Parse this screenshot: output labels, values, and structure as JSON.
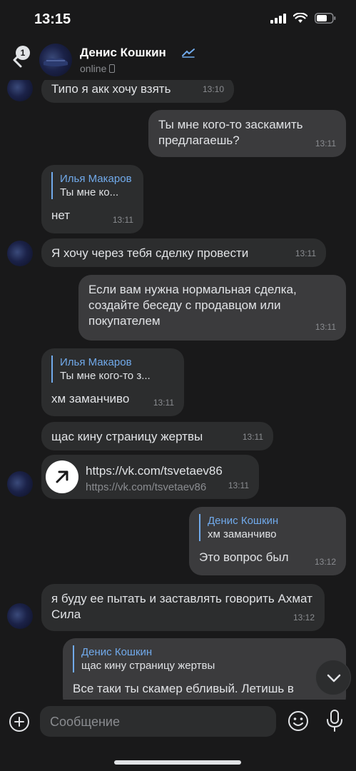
{
  "status": {
    "time": "13:15"
  },
  "header": {
    "back_badge": "1",
    "name": "Денис Кошкин",
    "status": "online"
  },
  "messages": [
    {
      "text": "Типо я акк хочу взять",
      "time": "13:10"
    },
    {
      "text": "Ты мне кого-то заскамить предлагаешь?",
      "time": "13:11"
    },
    {
      "reply_name": "Илья Макаров",
      "reply_text": "Ты мне ко...",
      "text": "нет",
      "time": "13:11"
    },
    {
      "text": "Я хочу через тебя сделку провести",
      "time": "13:11"
    },
    {
      "text": "Если вам нужна нормальная сделка, создайте беседу с продавцом или покупателем",
      "time": "13:11"
    },
    {
      "reply_name": "Илья Макаров",
      "reply_text": "Ты мне кого-то з...",
      "text": "хм заманчиво",
      "time": "13:11"
    },
    {
      "text": "щас кину страницу жертвы",
      "time": "13:11"
    },
    {
      "link_title": "https://vk.com/tsvetaev86",
      "link_sub": "https://vk.com/tsvetaev86",
      "time": "13:11"
    },
    {
      "reply_name": "Денис Кошкин",
      "reply_text": "хм заманчиво",
      "text": "Это вопрос был",
      "time": "13:12"
    },
    {
      "text": "я буду ее пытать и заставлять говорить Ахмат Сила",
      "time": "13:12"
    },
    {
      "reply_name": "Денис Кошкин",
      "reply_text": "щас кину страницу жертвы",
      "text": "Все таки ты скамер ебливый. Летишь в"
    }
  ],
  "composer": {
    "placeholder": "Сообщение"
  },
  "icons": [
    "back-arrow-icon",
    "verified-icon",
    "arrow-up-right-icon",
    "plus-icon",
    "smile-icon",
    "mic-icon",
    "chevron-down-icon",
    "signal-icon",
    "wifi-icon",
    "battery-icon"
  ],
  "colors": {
    "background": "#19191a",
    "incoming": "#2c2d2e",
    "outgoing": "#3b3b3d",
    "accent": "#71aaeb"
  }
}
